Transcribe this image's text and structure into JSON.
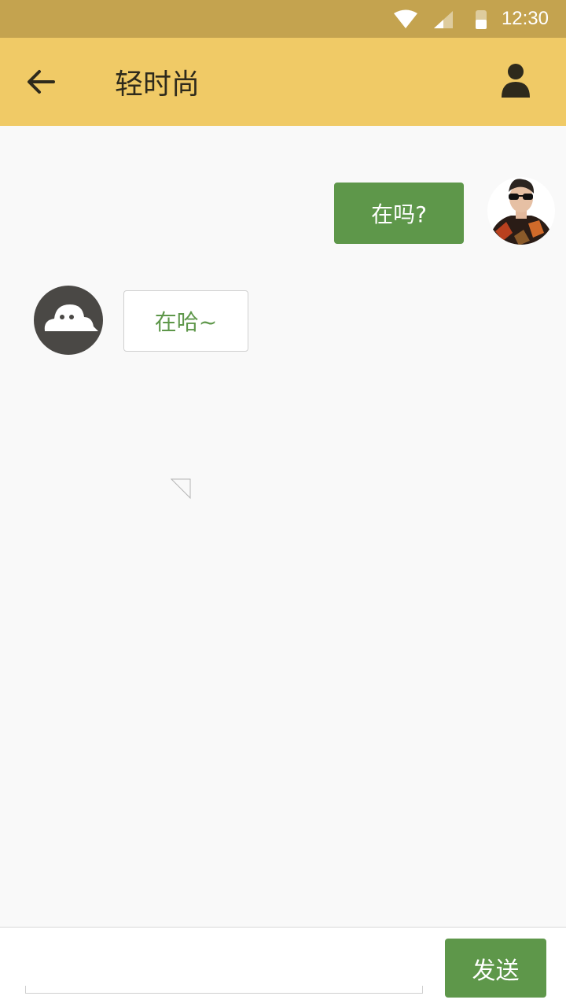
{
  "status_bar": {
    "time": "12:30",
    "icons": [
      "wifi-icon",
      "signal-icon",
      "battery-icon"
    ]
  },
  "app_bar": {
    "title": "轻时尚",
    "back_icon": "arrow-left-icon",
    "profile_icon": "person-icon"
  },
  "messages": [
    {
      "direction": "outgoing",
      "text": "在吗?",
      "avatar": "user-photo-avatar"
    },
    {
      "direction": "incoming",
      "text": "在哈~",
      "avatar": "cloud-chat-avatar"
    }
  ],
  "composer": {
    "input_value": "",
    "send_label": "发送"
  },
  "colors": {
    "status_bar": "#c4a34f",
    "app_bar": "#f0ca66",
    "accent_green": "#5e974a",
    "background": "#f9f9f9"
  }
}
